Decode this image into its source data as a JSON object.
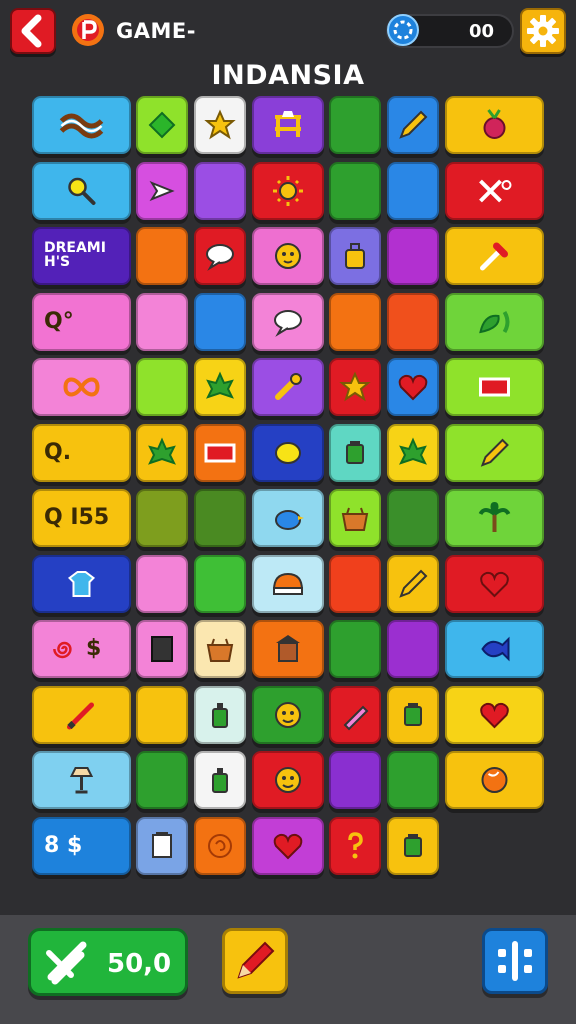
{
  "header": {
    "game_title": "GAME-",
    "coins": "00",
    "level_name": "INDANSIA"
  },
  "footer": {
    "score": "50,0"
  },
  "tiles": [
    {
      "color": "#3fb6ec",
      "w": "wide",
      "icon": "bacon-icon"
    },
    {
      "color": "#8fe22b",
      "icon": "diamond-icon"
    },
    {
      "color": "#f4f4f4",
      "icon": "star-icon"
    },
    {
      "color": "#8a3fd8",
      "icon": "gate-icon"
    },
    {
      "color": "#2ea02e",
      "icon": ""
    },
    {
      "color": "#2a87e6",
      "icon": "pencil-icon"
    },
    {
      "color": "#f7c20e",
      "w": "wide",
      "icon": "beet-icon"
    },
    {
      "color": "#3fb6ec",
      "w": "wide",
      "icon": "magnifier-icon"
    },
    {
      "color": "#d64fe0",
      "icon": "arrow-icon"
    },
    {
      "color": "#9b4ee4",
      "icon": ""
    },
    {
      "color": "#e01b24",
      "icon": "sun-icon"
    },
    {
      "color": "#2ea02e",
      "icon": ""
    },
    {
      "color": "#2a87e6",
      "icon": ""
    },
    {
      "color": "#e01b24",
      "w": "wide",
      "icon": "scissors-icon"
    },
    {
      "color": "#5321b8",
      "w": "wide",
      "text": "DREAMI H'S",
      "icon": ""
    },
    {
      "color": "#f37212",
      "icon": ""
    },
    {
      "color": "#e01b24",
      "icon": "speech-icon"
    },
    {
      "color": "#ee6fd0",
      "icon": "lion-face-icon"
    },
    {
      "color": "#7c6fe2",
      "icon": "bag-icon"
    },
    {
      "color": "#b230d0",
      "icon": ""
    },
    {
      "color": "#f7c20e",
      "w": "wide",
      "icon": "dropper-icon"
    },
    {
      "color": "#f273d2",
      "w": "wide",
      "text": "Q°",
      "icon": ""
    },
    {
      "color": "#f383d7",
      "icon": ""
    },
    {
      "color": "#2a87e6",
      "icon": ""
    },
    {
      "color": "#f383d7",
      "icon": "speech-icon"
    },
    {
      "color": "#f37212",
      "icon": ""
    },
    {
      "color": "#f0501c",
      "icon": ""
    },
    {
      "color": "#6fd43a",
      "w": "wide",
      "icon": "pepper-icon"
    },
    {
      "color": "#f383d7",
      "w": "wide",
      "icon": "infinity-icon"
    },
    {
      "color": "#8fe22b",
      "icon": ""
    },
    {
      "color": "#f7d316",
      "icon": "leaf-icon"
    },
    {
      "color": "#9b4ee4",
      "icon": "key-icon"
    },
    {
      "color": "#e01b24",
      "icon": "star-icon"
    },
    {
      "color": "#2a87e6",
      "icon": "heart-icon"
    },
    {
      "color": "#8fe22b",
      "w": "wide",
      "icon": "flag-icon"
    },
    {
      "color": "#f7c20e",
      "w": "wide",
      "text": "Q.",
      "icon": ""
    },
    {
      "color": "#f7c20e",
      "icon": "leaf-icon"
    },
    {
      "color": "#f37212",
      "icon": "flag-icon"
    },
    {
      "color": "#2540c4",
      "icon": "lemon-icon"
    },
    {
      "color": "#5fd7c3",
      "icon": "jar-icon"
    },
    {
      "color": "#f7d316",
      "icon": "leaf-icon"
    },
    {
      "color": "#8fe22b",
      "w": "wide",
      "icon": "pencil-icon"
    },
    {
      "color": "#f7c20e",
      "w": "wide",
      "text": "Q I55",
      "icon": ""
    },
    {
      "color": "#7e9e1e",
      "icon": ""
    },
    {
      "color": "#4a8a22",
      "icon": ""
    },
    {
      "color": "#8fd8ef",
      "icon": "bird-icon"
    },
    {
      "color": "#8fe22b",
      "icon": "basket-icon"
    },
    {
      "color": "#3a8f2a",
      "icon": ""
    },
    {
      "color": "#6fd43a",
      "w": "wide",
      "icon": "palm-icon"
    },
    {
      "color": "#2540c4",
      "w": "wide",
      "icon": "shirt-icon"
    },
    {
      "color": "#f383d7",
      "icon": ""
    },
    {
      "color": "#3fbf36",
      "icon": ""
    },
    {
      "color": "#bde9f6",
      "icon": "cake-icon"
    },
    {
      "color": "#f0401c",
      "icon": ""
    },
    {
      "color": "#f7c20e",
      "icon": "pencil-icon"
    },
    {
      "color": "#e01b24",
      "w": "wide",
      "icon": "heart-icon"
    },
    {
      "color": "#f383d7",
      "w": "wide",
      "text": "$",
      "icon": "spiral-icon"
    },
    {
      "color": "#f383d7",
      "icon": "box-icon"
    },
    {
      "color": "#fbe7b0",
      "icon": "basket-icon"
    },
    {
      "color": "#f37212",
      "icon": "lantern-icon"
    },
    {
      "color": "#2ea02e",
      "icon": ""
    },
    {
      "color": "#9b2fd0",
      "icon": ""
    },
    {
      "color": "#3fb6ec",
      "w": "wide",
      "icon": "fish-icon"
    },
    {
      "color": "#f7c20e",
      "w": "wide",
      "icon": "brush-icon"
    },
    {
      "color": "#f7c20e",
      "icon": ""
    },
    {
      "color": "#d8f2ec",
      "icon": "bottle-icon"
    },
    {
      "color": "#2ea02e",
      "icon": "face-icon"
    },
    {
      "color": "#e01b24",
      "icon": "eraser-icon"
    },
    {
      "color": "#f7c20e",
      "icon": "jar-icon"
    },
    {
      "color": "#f7d316",
      "w": "wide",
      "icon": "heart-icon"
    },
    {
      "color": "#7fd0f0",
      "w": "wide",
      "icon": "lamp-icon"
    },
    {
      "color": "#2ea02e",
      "icon": ""
    },
    {
      "color": "#f5f5f5",
      "icon": "bottle-icon"
    },
    {
      "color": "#e01b24",
      "icon": "face-icon"
    },
    {
      "color": "#8a2fd0",
      "icon": ""
    },
    {
      "color": "#2ea02e",
      "icon": ""
    },
    {
      "color": "#f7c20e",
      "w": "wide",
      "icon": "ball-icon"
    },
    {
      "color": "#1e82dc",
      "w": "wide",
      "text": "8 $",
      "icon": ""
    },
    {
      "color": "#7aa4e6",
      "icon": "notepad-icon"
    },
    {
      "color": "#f37212",
      "icon": "swirl-icon"
    },
    {
      "color": "#c23ed6",
      "icon": "heart-icon"
    },
    {
      "color": "#e01b24",
      "icon": "question-icon"
    },
    {
      "color": "#f7c20e",
      "icon": "jar-icon"
    }
  ]
}
